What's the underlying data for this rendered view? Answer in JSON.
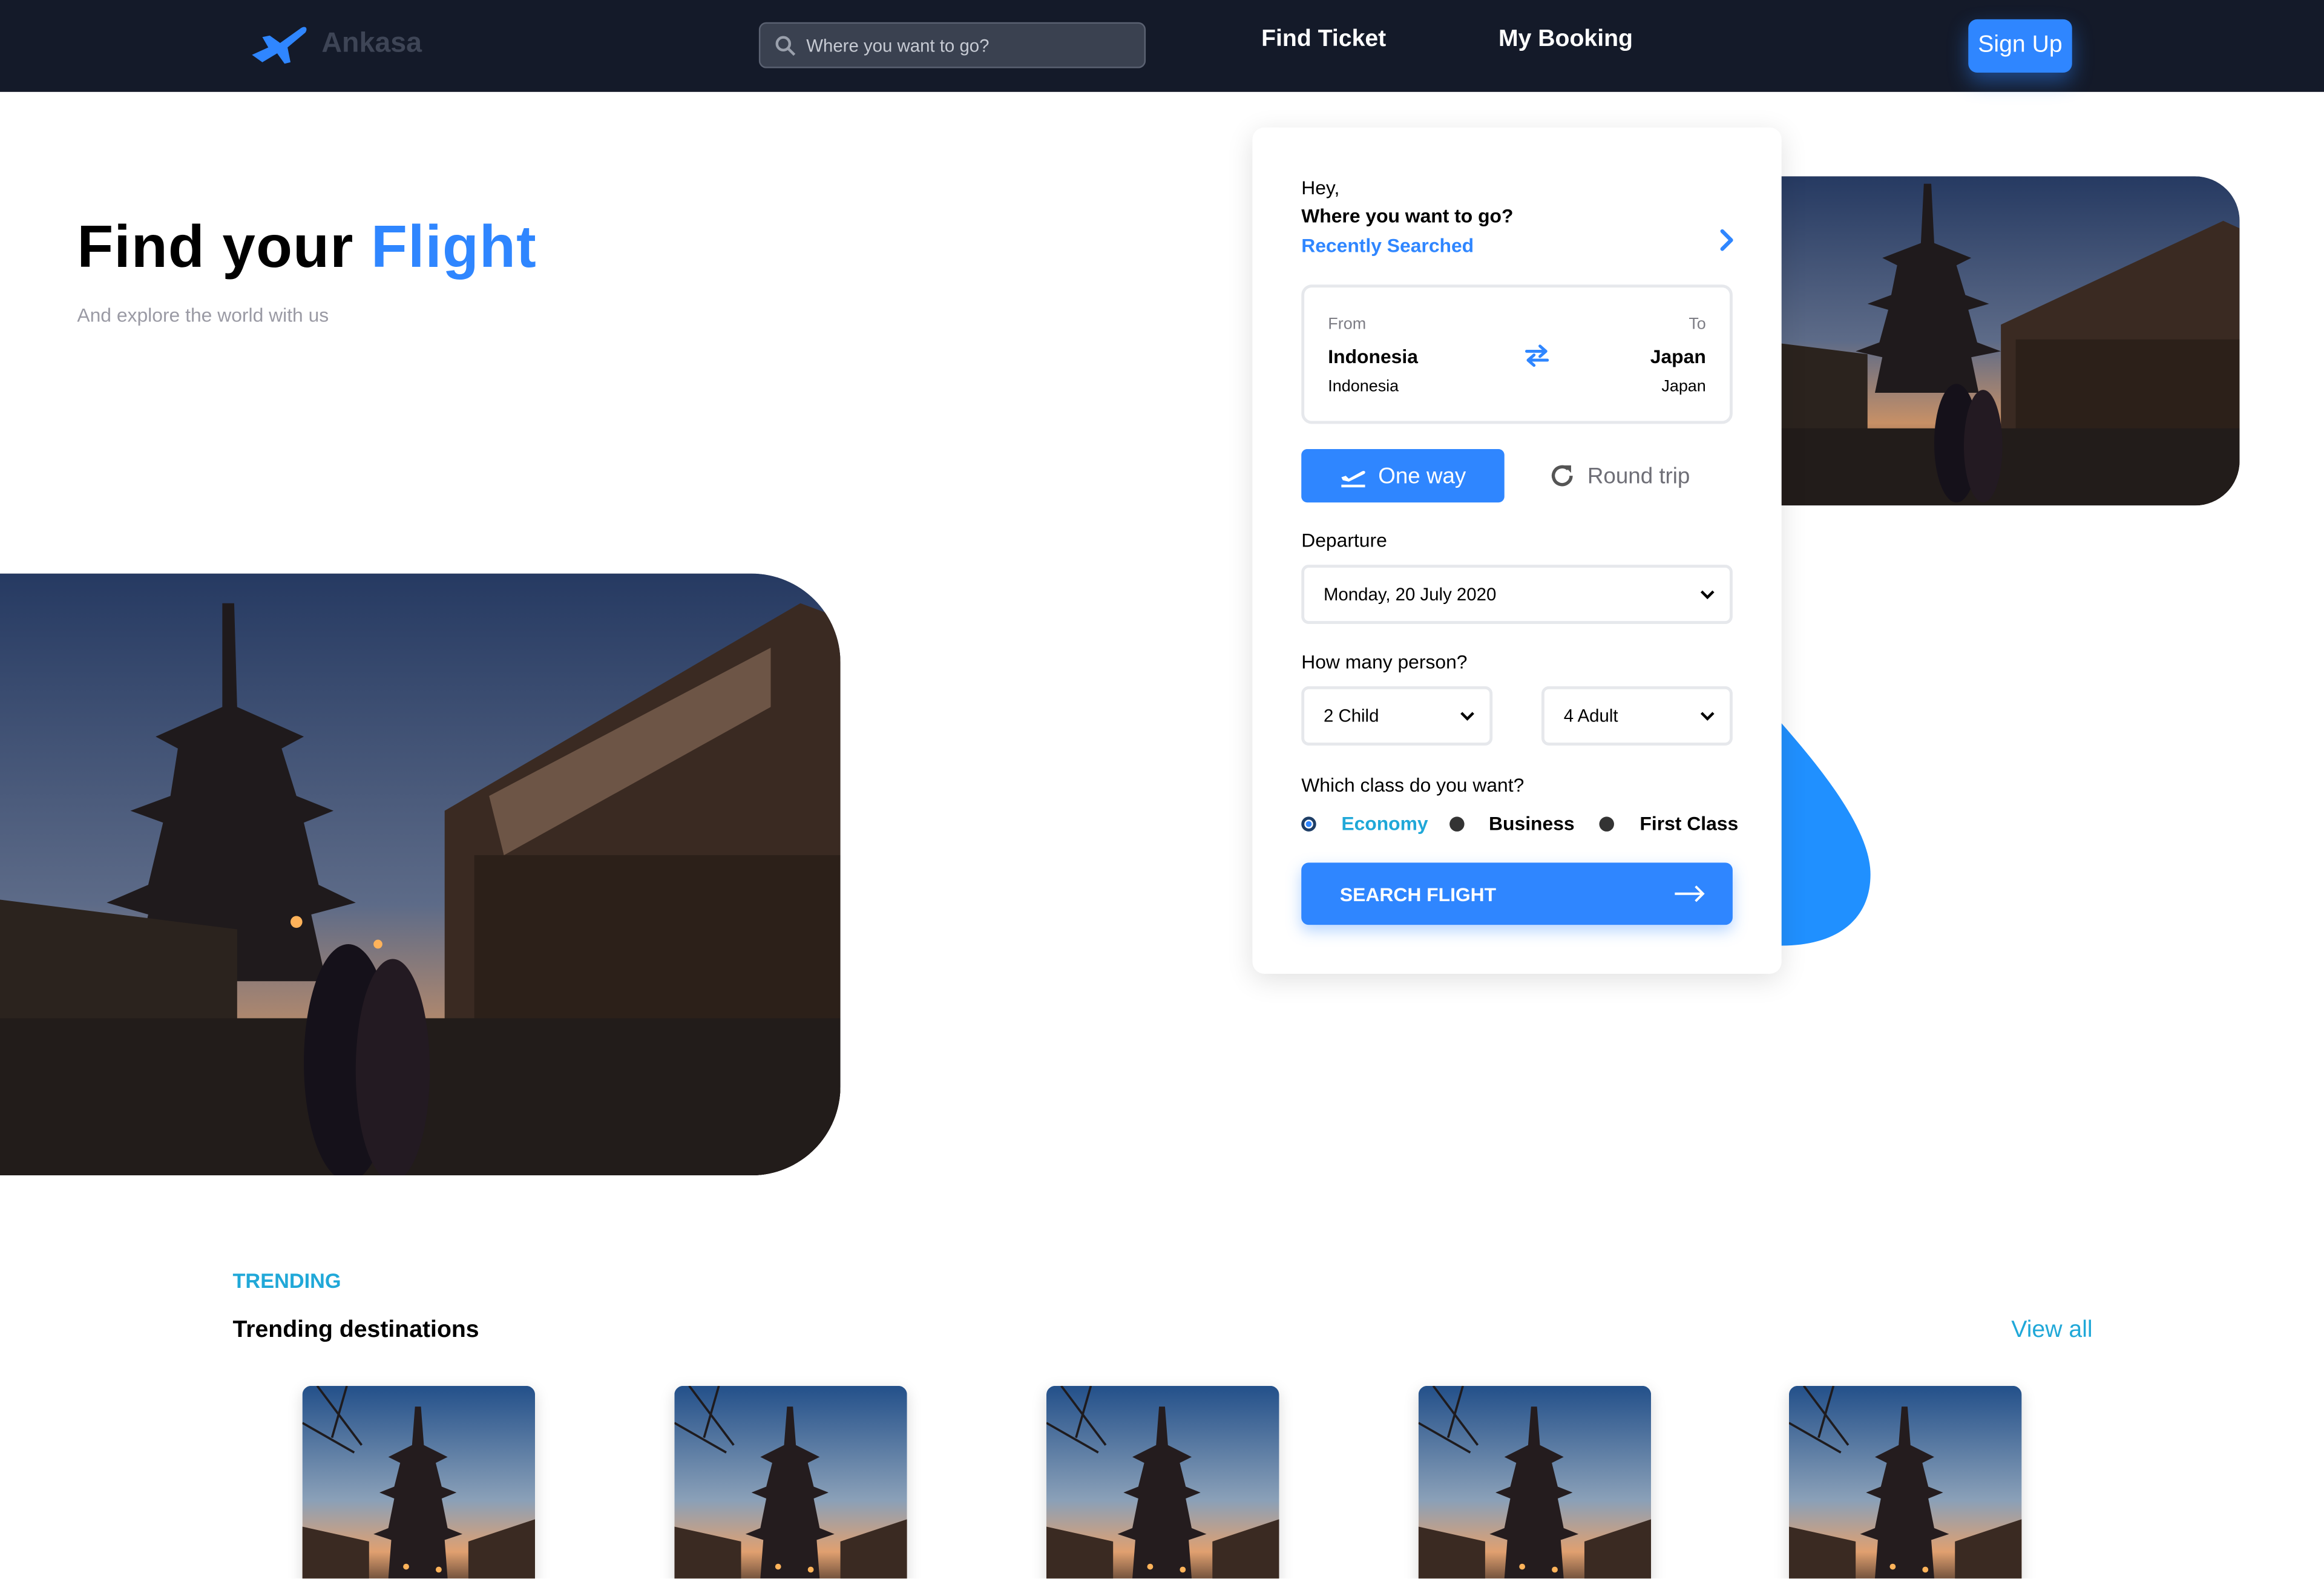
{
  "header": {
    "brand": "Ankasa",
    "search_placeholder": "Where you want to go?",
    "nav": [
      "Find Ticket",
      "My Booking"
    ],
    "signup_label": "Sign Up"
  },
  "hero": {
    "title_prefix": "Find your ",
    "title_accent": "Flight",
    "subtitle": "And explore the world with us"
  },
  "booking": {
    "greeting": "Hey,",
    "question": "Where you want to go?",
    "recently": "Recently Searched",
    "from_label": "From",
    "to_label": "To",
    "from_city": "Indonesia",
    "from_country": "Indonesia",
    "to_city": "Japan",
    "to_country": "Japan",
    "trip_one": "One way",
    "trip_round": "Round trip",
    "departure_label": "Departure",
    "departure_value": "Monday, 20 July 2020",
    "person_label": "How many person?",
    "child_value": "2 Child",
    "adult_value": "4 Adult",
    "class_label": "Which class do you want?",
    "classes": [
      "Economy",
      "Business",
      "First Class"
    ],
    "selected_class": "Economy",
    "search_button": "SEARCH FLIGHT"
  },
  "trending": {
    "kicker": "TRENDING",
    "title": "Trending destinations",
    "view_all": "View all",
    "card_count": 5
  },
  "colors": {
    "accent": "#2f86ff",
    "teal": "#20a8d8",
    "header_bg": "#141a29"
  }
}
